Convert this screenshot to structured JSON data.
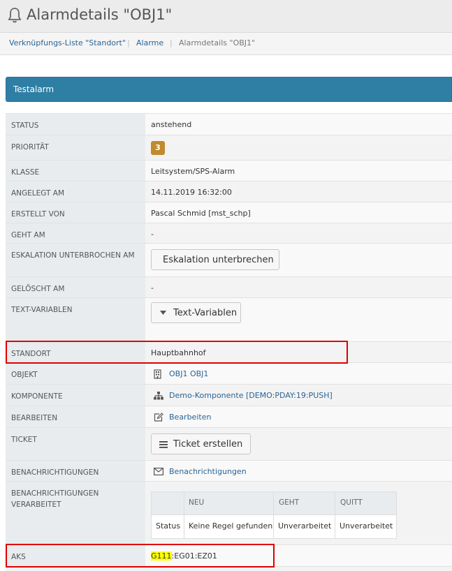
{
  "header": {
    "title": "Alarmdetails \"OBJ1\"",
    "icon": "bell-icon"
  },
  "breadcrumb": [
    {
      "label": "Verknüpfungs-Liste \"Standort\""
    },
    {
      "label": "Alarme"
    },
    {
      "label": "Alarmdetails \"OBJ1\""
    }
  ],
  "breadcrumb_separator": "|",
  "panel": {
    "title": "Testalarm",
    "color": "#2f7fa5"
  },
  "details": {
    "status": {
      "label": "STATUS",
      "value": "anstehend"
    },
    "priority": {
      "label": "PRIORITÄT",
      "value": "3",
      "color": "#c08a2e"
    },
    "class": {
      "label": "KLASSE",
      "value": "Leitsystem/SPS-Alarm"
    },
    "created_at": {
      "label": "ANGELEGT AM",
      "value": "14.11.2019 16:32:00"
    },
    "created_by": {
      "label": "ERSTELLT VON",
      "value": "Pascal Schmid [mst_schp]"
    },
    "goes_at": {
      "label": "GEHT AM",
      "value": "-"
    },
    "escalation": {
      "label": "ESKALATION UNTERBROCHEN AM",
      "button": "Eskalation unterbrechen"
    },
    "deleted_at": {
      "label": "GELÖSCHT AM",
      "value": "-"
    },
    "text_vars": {
      "label": "TEXT-VARIABLEN",
      "button": "Text-Variablen"
    },
    "location": {
      "label": "STANDORT",
      "value": "Hauptbahnhof"
    },
    "object": {
      "label": "OBJEKT",
      "value": "OBJ1 OBJ1"
    },
    "component": {
      "label": "KOMPONENTE",
      "value": "Demo-Komponente [DEMO:PDAY:19:PUSH]"
    },
    "edit": {
      "label": "BEARBEITEN",
      "value": "Bearbeiten"
    },
    "ticket": {
      "label": "TICKET",
      "button": "Ticket erstellen"
    },
    "notifications": {
      "label": "BENACHRICHTIGUNGEN",
      "value": "Benachrichtigungen"
    },
    "notif_processed": {
      "label_line1": "BENACHRICHTIGUNGEN",
      "label_line2": "VERARBEITET",
      "columns": [
        "",
        "NEU",
        "GEHT",
        "QUITT"
      ],
      "row": [
        "Status",
        "Keine Regel gefunden",
        "Unverarbeitet",
        "Unverarbeitet"
      ]
    },
    "aks": {
      "label": "AKS",
      "value_highlight": "G111",
      "value_rest": ":EG01:EZ01"
    }
  }
}
